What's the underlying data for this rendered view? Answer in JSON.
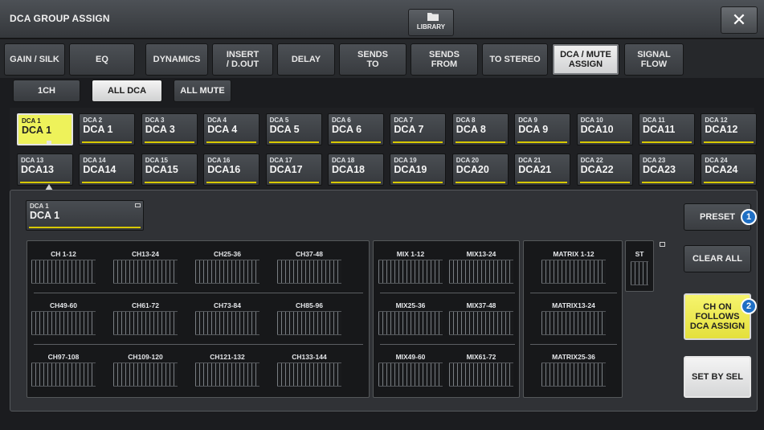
{
  "window": {
    "title": "DCA GROUP ASSIGN",
    "library_label": "LIBRARY",
    "close_symbol": "✕",
    "library_icon": "folder-icon"
  },
  "tabs": [
    {
      "label": "GAIN / SILK",
      "active": false
    },
    {
      "label": "EQ",
      "active": false
    },
    {
      "label": "DYNAMICS",
      "active": false
    },
    {
      "label": "INSERT\n/ D.OUT",
      "active": false
    },
    {
      "label": "DELAY",
      "active": false
    },
    {
      "label": "SENDS\nTO",
      "active": false
    },
    {
      "label": "SENDS\nFROM",
      "active": false
    },
    {
      "label": "TO STEREO",
      "active": false
    },
    {
      "label": "DCA / MUTE\nASSIGN",
      "active": true
    },
    {
      "label": "SIGNAL\nFLOW",
      "active": false
    }
  ],
  "modes": [
    {
      "label": "1CH",
      "active": false
    },
    {
      "label": "ALL DCA",
      "active": true
    },
    {
      "label": "ALL MUTE",
      "active": false
    }
  ],
  "dca_buttons": [
    {
      "num": "DCA 1",
      "name": "DCA 1",
      "selected": true
    },
    {
      "num": "DCA 2",
      "name": "DCA 1"
    },
    {
      "num": "DCA 3",
      "name": "DCA 3"
    },
    {
      "num": "DCA 4",
      "name": "DCA 4"
    },
    {
      "num": "DCA 5",
      "name": "DCA 5"
    },
    {
      "num": "DCA 6",
      "name": "DCA 6"
    },
    {
      "num": "DCA 7",
      "name": "DCA 7"
    },
    {
      "num": "DCA 8",
      "name": "DCA 8"
    },
    {
      "num": "DCA 9",
      "name": "DCA 9"
    },
    {
      "num": "DCA 10",
      "name": "DCA10"
    },
    {
      "num": "DCA 11",
      "name": "DCA11"
    },
    {
      "num": "DCA 12",
      "name": "DCA12"
    },
    {
      "num": "DCA 13",
      "name": "DCA13"
    },
    {
      "num": "DCA 14",
      "name": "DCA14"
    },
    {
      "num": "DCA 15",
      "name": "DCA15"
    },
    {
      "num": "DCA 16",
      "name": "DCA16"
    },
    {
      "num": "DCA 17",
      "name": "DCA17"
    },
    {
      "num": "DCA 18",
      "name": "DCA18"
    },
    {
      "num": "DCA 19",
      "name": "DCA19"
    },
    {
      "num": "DCA 20",
      "name": "DCA20"
    },
    {
      "num": "DCA 21",
      "name": "DCA21"
    },
    {
      "num": "DCA 22",
      "name": "DCA22"
    },
    {
      "num": "DCA 23",
      "name": "DCA23"
    },
    {
      "num": "DCA 24",
      "name": "DCA24"
    }
  ],
  "selected_dca": {
    "num": "DCA 1",
    "name": "DCA 1"
  },
  "channel_groups": {
    "input": [
      "CH 1-12",
      "CH13-24",
      "CH25-36",
      "CH37-48",
      "CH49-60",
      "CH61-72",
      "CH73-84",
      "CH85-96",
      "CH97-108",
      "CH109-120",
      "CH121-132",
      "CH133-144"
    ],
    "mix": [
      "MIX 1-12",
      "MIX13-24",
      "MIX25-36",
      "MIX37-48",
      "MIX49-60",
      "MIX61-72"
    ],
    "matrix": [
      "MATRIX 1-12",
      "MATRIX13-24",
      "MATRIX25-36"
    ],
    "st": "ST"
  },
  "buttons": {
    "preset": "PRESET",
    "clear_all": "CLEAR ALL",
    "ch_on_follows": "CH ON\nFOLLOWS\nDCA ASSIGN",
    "set_by_sel": "SET BY SEL"
  },
  "callouts": [
    "1",
    "2"
  ],
  "colors": {
    "accent_yellow": "#eef25a",
    "dca_bar": "#d7c800",
    "callout_blue": "#1f6fc4"
  }
}
